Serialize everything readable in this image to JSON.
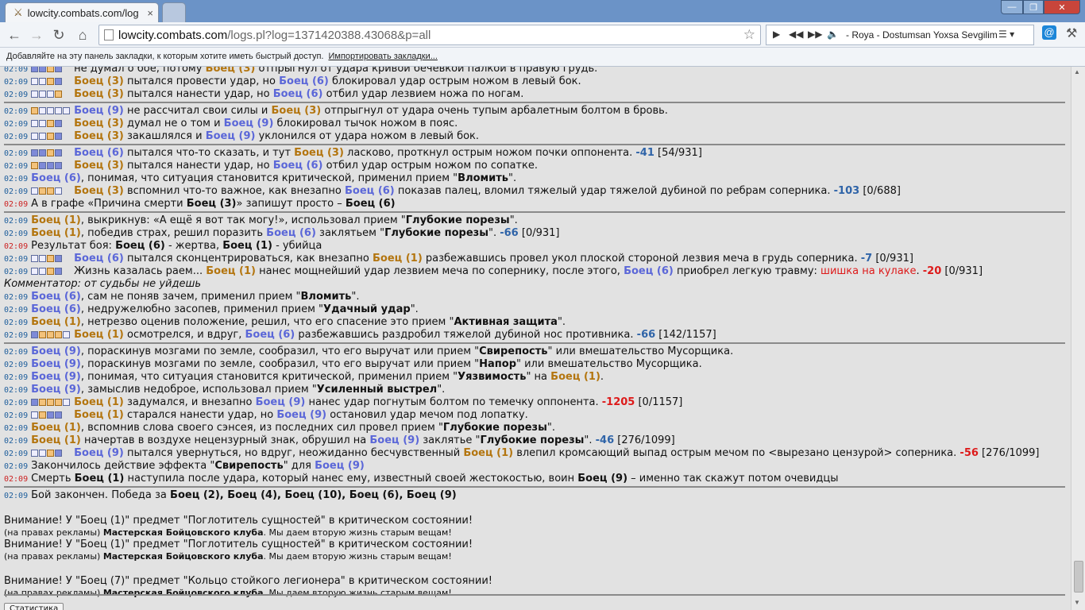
{
  "tab": {
    "title": "lowcity.combats.com/log",
    "close": "×"
  },
  "window": {
    "min": "—",
    "max": "❐",
    "close": "✕"
  },
  "nav": {
    "back": "←",
    "forward": "→",
    "reload": "↻",
    "home": "⌂"
  },
  "address": {
    "host": "lowcity.combats.com",
    "path": "/logs.pl?log=1371420388.43068&p=all",
    "star": "☆"
  },
  "player": {
    "play": "▶",
    "prev": "◀◀",
    "next": "▶▶",
    "volume": "🔈",
    "song": "- Roya - Dostumsan Yoxsa Sevgilim",
    "menu": "☰ ▾"
  },
  "ext": {
    "label": "@"
  },
  "wrench": "⚒",
  "bookmarks": {
    "text": "Добавляйте на эту панель закладки, к которым хотите иметь быстрый доступ.",
    "import": "Импортировать закладки..."
  },
  "log": [
    {
      "type": "row",
      "time": "02:09",
      "zones": "ddhd",
      "parts": [
        [
          "n",
          "не думал о бое, потому "
        ],
        [
          "f1",
          "Боец (3)"
        ],
        [
          "n",
          " отпрыгнул от удара кривой бечёвкой палкой в правую грудь."
        ]
      ]
    },
    {
      "type": "row",
      "time": "02:09",
      "zones": "eehd",
      "parts": [
        [
          "f1",
          "Боец (3)"
        ],
        [
          "n",
          " пытался провести удар, но "
        ],
        [
          "f2",
          "Боец (6)"
        ],
        [
          "n",
          " блокировал удар острым ножом в левый бок."
        ]
      ]
    },
    {
      "type": "row",
      "time": "02:09",
      "zones": "eeeh",
      "parts": [
        [
          "f1",
          "Боец (3)"
        ],
        [
          "n",
          " пытался нанести удар, но "
        ],
        [
          "f2",
          "Боец (6)"
        ],
        [
          "n",
          " отбил удар лезвием ножа по ногам."
        ]
      ]
    },
    {
      "type": "sep"
    },
    {
      "type": "row",
      "time": "02:09",
      "zones": "heeee",
      "parts": [
        [
          "f2",
          "Боец (9)"
        ],
        [
          "n",
          " не рассчитал свои силы и "
        ],
        [
          "f1",
          "Боец (3)"
        ],
        [
          "n",
          " отпрыгнул от удара очень тупым арбалетным болтом в бровь."
        ]
      ]
    },
    {
      "type": "row",
      "time": "02:09",
      "zones": "eehd",
      "parts": [
        [
          "f1",
          "Боец (3)"
        ],
        [
          "n",
          " думал не о том и "
        ],
        [
          "f2",
          "Боец (9)"
        ],
        [
          "n",
          " блокировал тычок ножом в пояс."
        ]
      ]
    },
    {
      "type": "row",
      "time": "02:09",
      "zones": "eehd",
      "parts": [
        [
          "f1",
          "Боец (3)"
        ],
        [
          "n",
          " закашлялся и "
        ],
        [
          "f2",
          "Боец (9)"
        ],
        [
          "n",
          " уклонился от удара ножом в левый бок."
        ]
      ]
    },
    {
      "type": "sep"
    },
    {
      "type": "row",
      "time": "02:09",
      "zones": "ddhd",
      "parts": [
        [
          "f2",
          "Боец (6)"
        ],
        [
          "n",
          " пытался что-то сказать, и тут "
        ],
        [
          "f1",
          "Боец (3)"
        ],
        [
          "n",
          " ласково, проткнул острым ножом почки оппонента. "
        ],
        [
          "dmg",
          "-41"
        ],
        [
          "n",
          " [54/931]"
        ]
      ]
    },
    {
      "type": "row",
      "time": "02:09",
      "zones": "hddd",
      "parts": [
        [
          "f1",
          "Боец (3)"
        ],
        [
          "n",
          " пытался нанести удар, но "
        ],
        [
          "f2",
          "Боец (6)"
        ],
        [
          "n",
          " отбил удар острым ножом по сопатке."
        ]
      ]
    },
    {
      "type": "row",
      "time": "02:09",
      "zones": "",
      "parts": [
        [
          "f2",
          "Боец (6)"
        ],
        [
          "n",
          ", понимая, что ситуация становится критической, применил прием \""
        ],
        [
          "b",
          "Вломить"
        ],
        [
          "n",
          "\"."
        ]
      ]
    },
    {
      "type": "row",
      "time": "02:09",
      "zones": "ehhe",
      "parts": [
        [
          "f1",
          "Боец (3)"
        ],
        [
          "n",
          " вспомнил что-то важное, как внезапно "
        ],
        [
          "f2",
          "Боец (6)"
        ],
        [
          "n",
          " показав палец, вломил тяжелый удар тяжелой дубиной по ребрам соперника. "
        ],
        [
          "dmg",
          "-103"
        ],
        [
          "n",
          " [0/688]"
        ]
      ]
    },
    {
      "type": "row",
      "time": "02:09",
      "red": true,
      "zones": "",
      "parts": [
        [
          "n",
          "А в графе «Причина смерти "
        ],
        [
          "b",
          "Боец (3)"
        ],
        [
          "n",
          "» запишут просто – "
        ],
        [
          "b",
          "Боец (6)"
        ]
      ]
    },
    {
      "type": "sep"
    },
    {
      "type": "row",
      "time": "02:09",
      "zones": "",
      "parts": [
        [
          "f1",
          "Боец (1)"
        ],
        [
          "n",
          ", выкрикнув: «А ещё я вот так могу!», использовал прием \""
        ],
        [
          "b",
          "Глубокие порезы"
        ],
        [
          "n",
          "\"."
        ]
      ]
    },
    {
      "type": "row",
      "time": "02:09",
      "zones": "",
      "parts": [
        [
          "f1",
          "Боец (1)"
        ],
        [
          "n",
          ", победив страх, решил поразить "
        ],
        [
          "f2",
          "Боец (6)"
        ],
        [
          "n",
          " заклятьем \""
        ],
        [
          "b",
          "Глубокие порезы"
        ],
        [
          "n",
          "\". "
        ],
        [
          "dmg",
          "-66"
        ],
        [
          "n",
          " [0/931]"
        ]
      ]
    },
    {
      "type": "row",
      "time": "02:09",
      "red": true,
      "zones": "",
      "parts": [
        [
          "n",
          "Результат боя: "
        ],
        [
          "b",
          "Боец (6)"
        ],
        [
          "n",
          " - жертва, "
        ],
        [
          "b",
          "Боец (1)"
        ],
        [
          "n",
          " - убийца"
        ]
      ]
    },
    {
      "type": "row",
      "time": "02:09",
      "zones": "eehd",
      "parts": [
        [
          "f2",
          "Боец (6)"
        ],
        [
          "n",
          " пытался сконцентрироваться, как внезапно "
        ],
        [
          "f1",
          "Боец (1)"
        ],
        [
          "n",
          " разбежавшись провел укол плоской стороной лезвия меча в грудь соперника. "
        ],
        [
          "dmg",
          "-7"
        ],
        [
          "n",
          " [0/931]"
        ]
      ]
    },
    {
      "type": "row",
      "time": "02:09",
      "zones": "eehd",
      "parts": [
        [
          "n",
          "Жизнь казалась раем... "
        ],
        [
          "f1",
          "Боец (1)"
        ],
        [
          "n",
          " нанес мощнейший удар лезвием меча по сопернику, после этого, "
        ],
        [
          "f2",
          "Боец (6)"
        ],
        [
          "n",
          " приобрел легкую травму: "
        ],
        [
          "inj",
          "шишка на кулаке"
        ],
        [
          "n",
          ". "
        ],
        [
          "dmgred",
          "-20"
        ],
        [
          "n",
          " [0/931]"
        ]
      ]
    },
    {
      "type": "note",
      "text": "Комментатор: от судьбы не уйдешь"
    },
    {
      "type": "row",
      "time": "02:09",
      "zones": "",
      "parts": [
        [
          "f2",
          "Боец (6)"
        ],
        [
          "n",
          ", сам не поняв зачем, применил прием \""
        ],
        [
          "b",
          "Вломить"
        ],
        [
          "n",
          "\"."
        ]
      ]
    },
    {
      "type": "row",
      "time": "02:09",
      "zones": "",
      "parts": [
        [
          "f2",
          "Боец (6)"
        ],
        [
          "n",
          ", недружелюбно засопев, применил прием \""
        ],
        [
          "b",
          "Удачный удар"
        ],
        [
          "n",
          "\"."
        ]
      ]
    },
    {
      "type": "row",
      "time": "02:09",
      "zones": "",
      "parts": [
        [
          "f1",
          "Боец (1)"
        ],
        [
          "n",
          ", нетрезво оценив положение, решил, что его спасение это прием \""
        ],
        [
          "b",
          "Активная защита"
        ],
        [
          "n",
          "\"."
        ]
      ]
    },
    {
      "type": "row",
      "time": "02:09",
      "zones": "dhhhe",
      "parts": [
        [
          "f1",
          "Боец (1)"
        ],
        [
          "n",
          " осмотрелся, и вдруг, "
        ],
        [
          "f2",
          "Боец (6)"
        ],
        [
          "n",
          " разбежавшись раздробил тяжелой дубиной нос противника. "
        ],
        [
          "dmg",
          "-66"
        ],
        [
          "n",
          " [142/1157]"
        ]
      ]
    },
    {
      "type": "sep"
    },
    {
      "type": "row",
      "time": "02:09",
      "zones": "",
      "parts": [
        [
          "f2",
          "Боец (9)"
        ],
        [
          "n",
          ", пораскинув мозгами по земле, сообразил, что его выручат или прием \""
        ],
        [
          "b",
          "Свирепость"
        ],
        [
          "n",
          "\" или вмешательство Мусорщика."
        ]
      ]
    },
    {
      "type": "row",
      "time": "02:09",
      "zones": "",
      "parts": [
        [
          "f2",
          "Боец (9)"
        ],
        [
          "n",
          ", пораскинув мозгами по земле, сообразил, что его выручат или прием \""
        ],
        [
          "b",
          "Напор"
        ],
        [
          "n",
          "\" или вмешательство Мусорщика."
        ]
      ]
    },
    {
      "type": "row",
      "time": "02:09",
      "zones": "",
      "parts": [
        [
          "f2",
          "Боец (9)"
        ],
        [
          "n",
          ", понимая, что ситуация становится критической, применил прием \""
        ],
        [
          "b",
          "Уязвимость"
        ],
        [
          "n",
          "\" на "
        ],
        [
          "f1",
          "Боец (1)"
        ],
        [
          "n",
          "."
        ]
      ]
    },
    {
      "type": "row",
      "time": "02:09",
      "zones": "",
      "parts": [
        [
          "f2",
          "Боец (9)"
        ],
        [
          "n",
          ", замыслив недоброе, использовал прием \""
        ],
        [
          "b",
          "Усиленный выстрел"
        ],
        [
          "n",
          "\"."
        ]
      ]
    },
    {
      "type": "row",
      "time": "02:09",
      "zones": "dhhhe",
      "parts": [
        [
          "f1",
          "Боец (1)"
        ],
        [
          "n",
          " задумался, и внезапно "
        ],
        [
          "f2",
          "Боец (9)"
        ],
        [
          "n",
          " нанес удар погнутым болтом по темечку оппонента. "
        ],
        [
          "dmgred",
          "-1205"
        ],
        [
          "n",
          " [0/1157]"
        ]
      ]
    },
    {
      "type": "row",
      "time": "02:09",
      "zones": "ehdd",
      "parts": [
        [
          "f1",
          "Боец (1)"
        ],
        [
          "n",
          " старался нанести удар, но "
        ],
        [
          "f2",
          "Боец (9)"
        ],
        [
          "n",
          " остановил удар мечом под лопатку."
        ]
      ]
    },
    {
      "type": "row",
      "time": "02:09",
      "zones": "",
      "parts": [
        [
          "f1",
          "Боец (1)"
        ],
        [
          "n",
          ", вспомнив слова своего сэнсея, из последних сил провел прием \""
        ],
        [
          "b",
          "Глубокие порезы"
        ],
        [
          "n",
          "\"."
        ]
      ]
    },
    {
      "type": "row",
      "time": "02:09",
      "zones": "",
      "parts": [
        [
          "f1",
          "Боец (1)"
        ],
        [
          "n",
          " начертав в воздухе нецензурный знак, обрушил на "
        ],
        [
          "f2",
          "Боец (9)"
        ],
        [
          "n",
          " заклятье \""
        ],
        [
          "b",
          "Глубокие порезы"
        ],
        [
          "n",
          "\". "
        ],
        [
          "dmg",
          "-46"
        ],
        [
          "n",
          " [276/1099]"
        ]
      ]
    },
    {
      "type": "row",
      "time": "02:09",
      "zones": "eehd",
      "parts": [
        [
          "f2",
          "Боец (9)"
        ],
        [
          "n",
          " пытался увернуться, но вдруг, неожиданно бесчувственный "
        ],
        [
          "f1",
          "Боец (1)"
        ],
        [
          "n",
          " влепил кромсающий выпад острым мечом по <вырезано цензурой> соперника. "
        ],
        [
          "dmgred",
          "-56"
        ],
        [
          "n",
          " [276/1099]"
        ]
      ]
    },
    {
      "type": "row",
      "time": "02:09",
      "zones": "",
      "parts": [
        [
          "n",
          "Закончилось действие эффекта \""
        ],
        [
          "b",
          "Свирепость"
        ],
        [
          "n",
          "\" для "
        ],
        [
          "f2",
          "Боец (9)"
        ]
      ]
    },
    {
      "type": "row",
      "time": "02:09",
      "red": true,
      "zones": "",
      "parts": [
        [
          "n",
          "Смерть "
        ],
        [
          "b",
          "Боец (1)"
        ],
        [
          "n",
          " наступила после удара, который нанес ему, известный своей жестокостью, воин "
        ],
        [
          "b",
          "Боец (9)"
        ],
        [
          "n",
          " – именно так скажут потом очевидцы"
        ]
      ]
    },
    {
      "type": "sep"
    },
    {
      "type": "row",
      "time": "02:09",
      "zones": "",
      "parts": [
        [
          "n",
          "Бой закончен. Победа за "
        ],
        [
          "b",
          "Боец (2), Боец (4), Боец (10), Боец (6), Боец (9)"
        ]
      ]
    },
    {
      "type": "gap"
    },
    {
      "type": "plain",
      "text": "Внимание! У \"Боец (1)\" предмет \"Поглотитель сущностей\" в критическом состоянии!"
    },
    {
      "type": "ad",
      "pre": "(на правах рекламы) ",
      "bold": "Мастерская Бойцовского клуба",
      "post": ". Мы даем вторую жизнь старым вещам!"
    },
    {
      "type": "plain",
      "text": "Внимание! У \"Боец (1)\" предмет \"Поглотитель сущностей\" в критическом состоянии!"
    },
    {
      "type": "ad",
      "pre": "(на правах рекламы) ",
      "bold": "Мастерская Бойцовского клуба",
      "post": ". Мы даем вторую жизнь старым вещам!"
    },
    {
      "type": "gap"
    },
    {
      "type": "plain",
      "text": "Внимание! У \"Боец (7)\" предмет \"Кольцо стойкого легионера\" в критическом состоянии!"
    },
    {
      "type": "ad",
      "pre": "(на правах рекламы) ",
      "bold": "Мастерская Бойцовского клуба",
      "post": ". Мы даем вторую жизнь старым вещам!"
    }
  ],
  "stats_button": "Статистика"
}
